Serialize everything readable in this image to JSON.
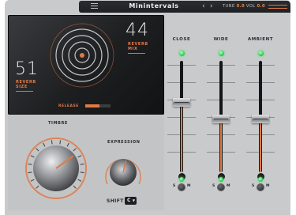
{
  "header": {
    "title": "Minintervals",
    "menu_icon": "hamburger-icon",
    "prev_glyph": "‹",
    "next_glyph": "›",
    "tune_label": "TUNE",
    "tune_value": "0.0",
    "vol_label": "VOL",
    "vol_value": "0.0",
    "accent_color": "#e07a45"
  },
  "display": {
    "reverb_size": {
      "value": "51",
      "label_line1": "REVERB",
      "label_line2": "SIZE"
    },
    "reverb_mix": {
      "value": "44",
      "label_line1": "REVERB",
      "label_line2": "MIX"
    },
    "release": {
      "label": "RELEASE",
      "level": 0.55
    }
  },
  "knobs": {
    "timbre": {
      "label": "TIMBRE",
      "level": 0.7
    },
    "expression": {
      "label": "EXPRESSION",
      "level": 0.55
    },
    "shift": {
      "label": "SHIFT",
      "value": "C",
      "dropdown_icon": "chevron-down-icon"
    }
  },
  "mixer": {
    "channels": [
      {
        "label": "CLOSE",
        "level": 0.63,
        "led_color": "#2fd157",
        "s_label": "S",
        "m_label": "M"
      },
      {
        "label": "WIDE",
        "level": 0.48,
        "led_color": "#2fd157",
        "s_label": "S",
        "m_label": "M"
      },
      {
        "label": "AMBIENT",
        "level": 0.48,
        "led_color": "#2fd157",
        "s_label": "S",
        "m_label": "M"
      }
    ]
  }
}
